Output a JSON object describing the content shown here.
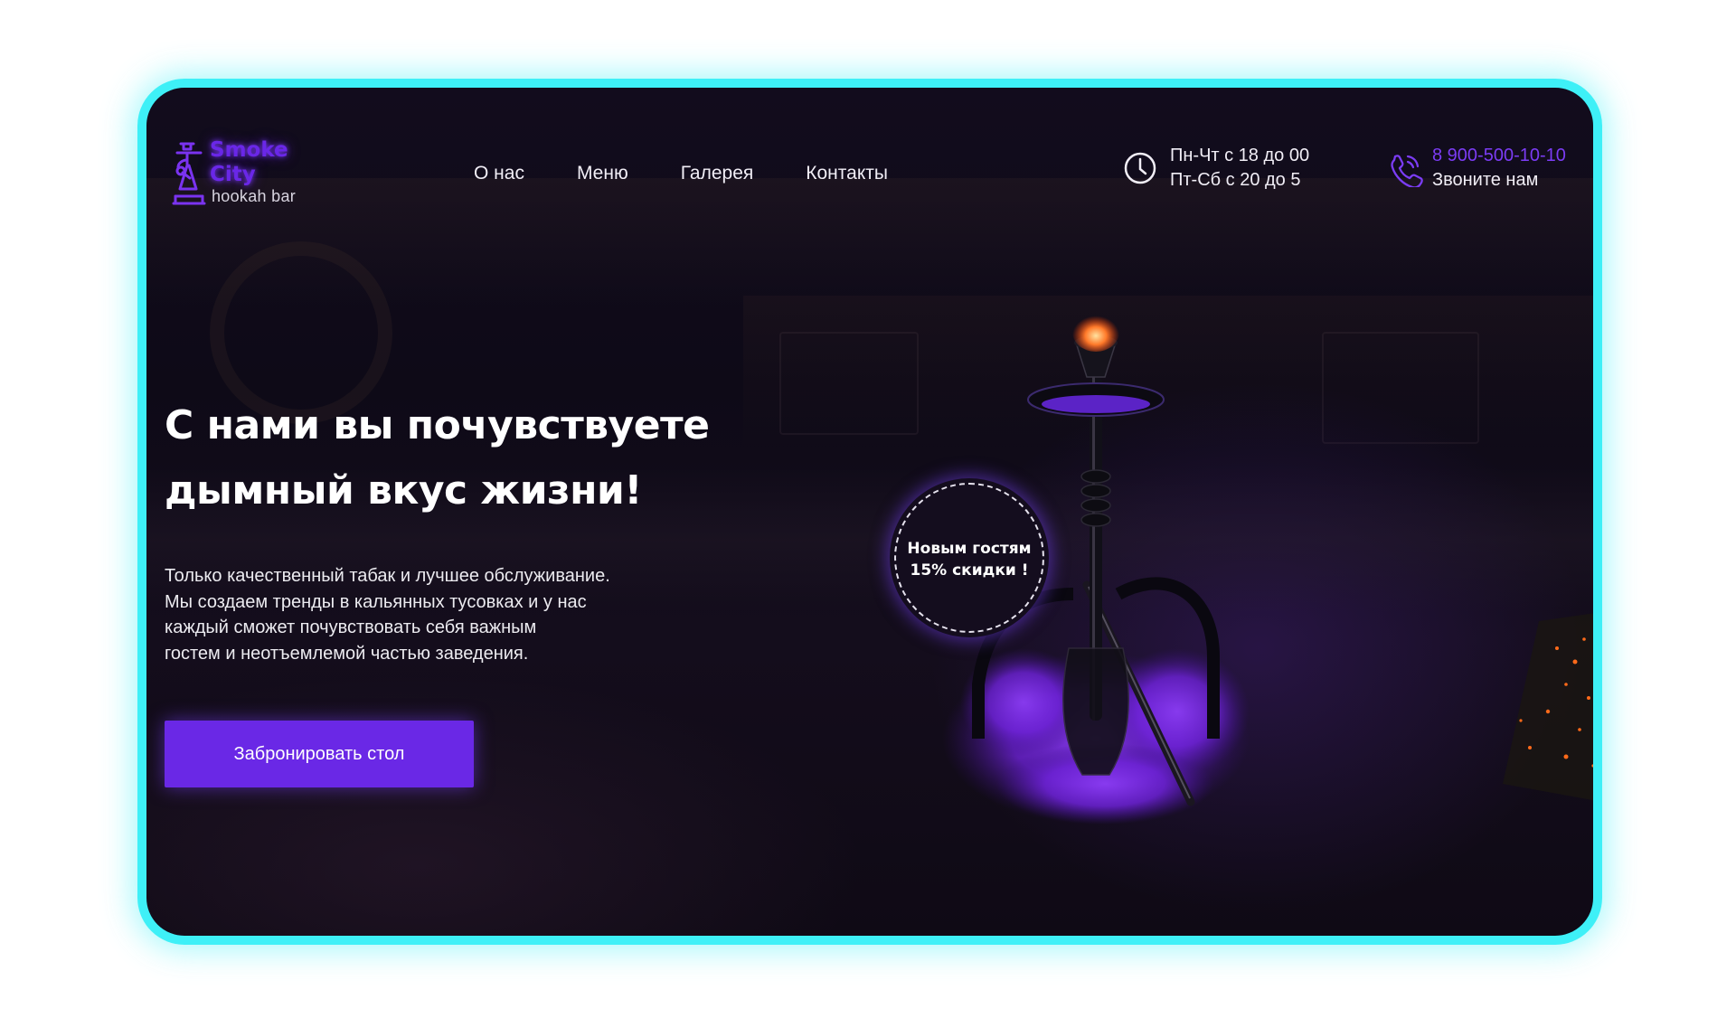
{
  "logo": {
    "name_line1": "Smoke",
    "name_line2": "City",
    "subtitle": "hookah bar",
    "icon": "hookah-logo-icon"
  },
  "nav": {
    "items": [
      {
        "label": "О нас"
      },
      {
        "label": "Меню"
      },
      {
        "label": "Галерея"
      },
      {
        "label": "Контакты"
      }
    ]
  },
  "hours": {
    "icon": "clock-icon",
    "line1": "Пн-Чт с 18 до 00",
    "line2": "Пт-Сб с 20 до 5"
  },
  "contact": {
    "icon": "phone-icon",
    "phone": "8 900-500-10-10",
    "cta": "Звоните нам"
  },
  "hero": {
    "title_line1": "С нами вы почувствуете",
    "title_line2": "дымный вкус жизни!",
    "description": "Только качественный табак и лучшее обслуживание.\nМы создаем тренды в кальянных тусовках и у нас\nкаждый сможет почувствовать себя важным\nгостем и неотъемлемой частью заведения.",
    "button_label": "Забронировать стол"
  },
  "promo_badge": {
    "line1": "Новым гостям",
    "line2": "15% скидки !"
  },
  "colors": {
    "accent": "#6a28e6",
    "frame": "#3ef0f7",
    "background": "#120c1d",
    "text": "#f1eef6"
  }
}
